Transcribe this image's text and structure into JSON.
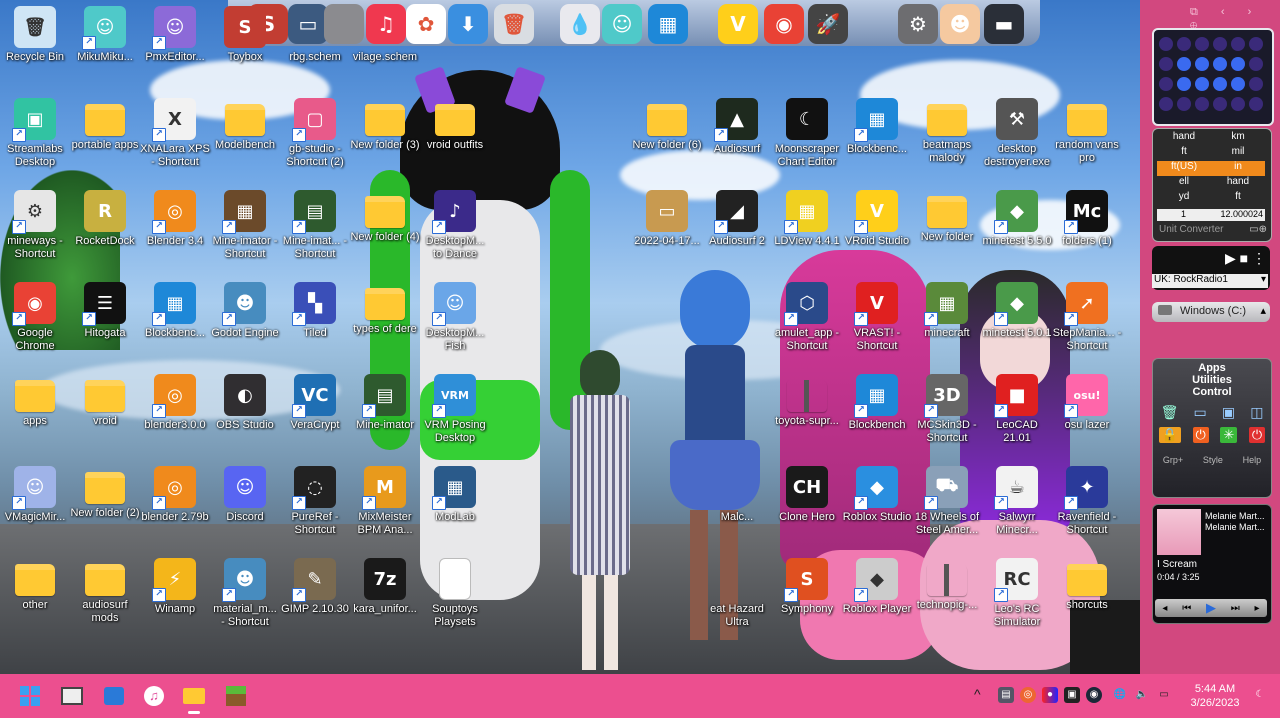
{
  "dock": {
    "items": [
      {
        "name": "toybox-dock",
        "glyph": "S",
        "bg": "#c23d32"
      },
      {
        "name": "monitor-dock",
        "glyph": "▭",
        "bg": "#3c5a80"
      },
      {
        "name": "apple-dock",
        "glyph": "",
        "bg": "#8b8b8f"
      },
      {
        "name": "music-dock",
        "glyph": "♫",
        "bg": "#f0384f"
      },
      {
        "name": "photos-dock",
        "glyph": "✿",
        "bg": "#ffffff"
      },
      {
        "name": "downloads-dock",
        "glyph": "⬇",
        "bg": "#3a8fe0"
      },
      {
        "name": "trash-dock",
        "glyph": "🗑",
        "bg": "#d9dde2"
      },
      {
        "name": "drop-dock",
        "glyph": "💧",
        "bg": "#e9e9ee"
      },
      {
        "name": "miku-dock",
        "glyph": "☺",
        "bg": "#4fc9c9"
      },
      {
        "name": "blockbench-dock",
        "glyph": "▦",
        "bg": "#1e88d8"
      },
      {
        "name": "vroid-dock",
        "glyph": "V",
        "bg": "#ffcf1a"
      },
      {
        "name": "chrome-dock",
        "glyph": "◉",
        "bg": "#e94235"
      },
      {
        "name": "rocket-dock",
        "glyph": "🚀",
        "bg": "#444"
      },
      {
        "name": "settings-dock",
        "glyph": "⚙",
        "bg": "#6d6d70"
      },
      {
        "name": "person-dock",
        "glyph": "☻",
        "bg": "#f5c9a0"
      },
      {
        "name": "window-dock",
        "glyph": "▬",
        "bg": "#2a2f38"
      }
    ]
  },
  "icons": [
    {
      "label": "Recycle Bin",
      "type": "bin",
      "glyph": "🗑",
      "bg": "#cfe5f5",
      "shortcut": false
    },
    {
      "label": "MikuMiku...",
      "type": "app",
      "glyph": "☺",
      "bg": "#4fc9c9",
      "shortcut": true
    },
    {
      "label": "PmxEditor...",
      "type": "app",
      "glyph": "☺",
      "bg": "#8c6ad8",
      "shortcut": true
    },
    {
      "label": "Toybox",
      "type": "app",
      "glyph": "S",
      "bg": "#c23d32",
      "shortcut": false
    },
    {
      "label": "rbg.schem",
      "type": "blank",
      "glyph": "",
      "bg": "transparent",
      "shortcut": false
    },
    {
      "label": "vilage.schem",
      "type": "blank",
      "glyph": "",
      "bg": "transparent",
      "shortcut": false
    },
    {
      "label": "Streamlabs Desktop",
      "type": "app",
      "glyph": "▣",
      "bg": "#31c3a2",
      "shortcut": true
    },
    {
      "label": "portable apps",
      "type": "folder",
      "shortcut": false
    },
    {
      "label": "XNALara XPS - Shortcut",
      "type": "app",
      "glyph": "X",
      "bg": "#f2f2f2",
      "shortcut": true
    },
    {
      "label": "Modelbench",
      "type": "folder",
      "shortcut": false
    },
    {
      "label": "gb-studio - Shortcut (2)",
      "type": "app",
      "glyph": "▢",
      "bg": "#e85a8a",
      "shortcut": true
    },
    {
      "label": "New folder (3)",
      "type": "folder",
      "shortcut": false
    },
    {
      "label": "vroid outfits",
      "type": "folder",
      "shortcut": false
    },
    {
      "label": "mineways - Shortcut",
      "type": "app",
      "glyph": "⚙",
      "bg": "#e6e6e6",
      "shortcut": true
    },
    {
      "label": "RocketDock",
      "type": "app",
      "glyph": "R",
      "bg": "#c8b040",
      "shortcut": false
    },
    {
      "label": "Blender 3.4",
      "type": "app",
      "glyph": "◎",
      "bg": "#f08a1c",
      "shortcut": true
    },
    {
      "label": "Mine-imator - Shortcut",
      "type": "app",
      "glyph": "▦",
      "bg": "#6b4a2a",
      "shortcut": true
    },
    {
      "label": "Mine-imat... - Shortcut",
      "type": "app",
      "glyph": "▤",
      "bg": "#2e5a2e",
      "shortcut": true
    },
    {
      "label": "New folder (4)",
      "type": "folder",
      "shortcut": false
    },
    {
      "label": "DesktopM... to Dance",
      "type": "app",
      "glyph": "♪",
      "bg": "#3b2a8a",
      "shortcut": true
    },
    {
      "label": "Google Chrome",
      "type": "app",
      "glyph": "◉",
      "bg": "#e94235",
      "shortcut": true
    },
    {
      "label": "Hitogata",
      "type": "app",
      "glyph": "☰",
      "bg": "#111111",
      "shortcut": true
    },
    {
      "label": "Blockbenc...",
      "type": "app",
      "glyph": "▦",
      "bg": "#1e88d8",
      "shortcut": true
    },
    {
      "label": "Godot Engine",
      "type": "app",
      "glyph": "☻",
      "bg": "#478cbf",
      "shortcut": true
    },
    {
      "label": "Tiled",
      "type": "app",
      "glyph": "▚",
      "bg": "#3a4fb8",
      "shortcut": true
    },
    {
      "label": "types of dere",
      "type": "folder",
      "shortcut": false
    },
    {
      "label": "DesktopM... Fish",
      "type": "app",
      "glyph": "☺",
      "bg": "#6aa6e8",
      "shortcut": true
    },
    {
      "label": "apps",
      "type": "folder",
      "shortcut": false
    },
    {
      "label": "vroid",
      "type": "folder",
      "shortcut": false
    },
    {
      "label": "blender3.0.0",
      "type": "app",
      "glyph": "◎",
      "bg": "#f08a1c",
      "shortcut": true
    },
    {
      "label": "OBS Studio",
      "type": "app",
      "glyph": "◐",
      "bg": "#302e31",
      "shortcut": false
    },
    {
      "label": "VeraCrypt",
      "type": "app",
      "glyph": "VC",
      "bg": "#1f6fb4",
      "shortcut": true
    },
    {
      "label": "Mine-imator",
      "type": "app",
      "glyph": "▤",
      "bg": "#2e5a2e",
      "shortcut": true
    },
    {
      "label": "VRM Posing Desktop",
      "type": "app",
      "glyph": "VRM",
      "bg": "#2f8fd8",
      "shortcut": true
    },
    {
      "label": "VMagicMir...",
      "type": "app",
      "glyph": "☺",
      "bg": "#9fb3e8",
      "shortcut": true
    },
    {
      "label": "New folder (2)",
      "type": "folder",
      "shortcut": false
    },
    {
      "label": "blender 2.79b",
      "type": "app",
      "glyph": "◎",
      "bg": "#f08a1c",
      "shortcut": true
    },
    {
      "label": "Discord",
      "type": "app",
      "glyph": "☺",
      "bg": "#5865f2",
      "shortcut": false
    },
    {
      "label": "PureRef - Shortcut",
      "type": "app",
      "glyph": "◌",
      "bg": "#222",
      "shortcut": true
    },
    {
      "label": "MixMeister BPM Ana...",
      "type": "app",
      "glyph": "M",
      "bg": "#e89a1c",
      "shortcut": true
    },
    {
      "label": "ModLab",
      "type": "app",
      "glyph": "▦",
      "bg": "#2a5a8a",
      "shortcut": true
    },
    {
      "label": "other",
      "type": "folder",
      "shortcut": false
    },
    {
      "label": "audiosurf mods",
      "type": "folder",
      "shortcut": false
    },
    {
      "label": "Winamp",
      "type": "app",
      "glyph": "⚡",
      "bg": "#f4b61a",
      "shortcut": true
    },
    {
      "label": "material_m... - Shortcut",
      "type": "app",
      "glyph": "☻",
      "bg": "#478cbf",
      "shortcut": true
    },
    {
      "label": "GIMP 2.10.30",
      "type": "app",
      "glyph": "✎",
      "bg": "#7a6a50",
      "shortcut": true
    },
    {
      "label": "kara_unifor...",
      "type": "app",
      "glyph": "7z",
      "bg": "#1a1a1a",
      "shortcut": false
    },
    {
      "label": "Souptoys Playsets",
      "type": "doc",
      "glyph": "",
      "bg": "#ffffff",
      "shortcut": false
    },
    {
      "label": "New folder (6)",
      "type": "folder",
      "shortcut": false
    },
    {
      "label": "Audiosurf",
      "type": "app",
      "glyph": "▲",
      "bg": "#1e2a1e",
      "shortcut": true
    },
    {
      "label": "Moonscraper Chart Editor",
      "type": "app",
      "glyph": "☾",
      "bg": "#111",
      "shortcut": false
    },
    {
      "label": "Blockbenc...",
      "type": "app",
      "glyph": "▦",
      "bg": "#1e88d8",
      "shortcut": true
    },
    {
      "label": "beatmaps malody",
      "type": "folder",
      "shortcut": false
    },
    {
      "label": "desktop destroyer.exe",
      "type": "app",
      "glyph": "⚒",
      "bg": "#555",
      "shortcut": false
    },
    {
      "label": "random vans pro",
      "type": "folder",
      "shortcut": false
    },
    {
      "label": "2022-04-17...",
      "type": "app",
      "glyph": "▭",
      "bg": "#c89a50",
      "shortcut": false
    },
    {
      "label": "Audiosurf 2",
      "type": "app",
      "glyph": "◢",
      "bg": "#222",
      "shortcut": true
    },
    {
      "label": "LDView 4.4.1",
      "type": "app",
      "glyph": "▦",
      "bg": "#f0d020",
      "shortcut": true
    },
    {
      "label": "VRoid Studio",
      "type": "app",
      "glyph": "V",
      "bg": "#ffcf1a",
      "shortcut": true
    },
    {
      "label": "New folder",
      "type": "folder",
      "shortcut": false
    },
    {
      "label": "minetest 5.5.0",
      "type": "app",
      "glyph": "◆",
      "bg": "#4a9a4a",
      "shortcut": true
    },
    {
      "label": "folders (1)",
      "type": "app",
      "glyph": "Mc",
      "bg": "#111",
      "shortcut": true
    },
    {
      "label": "amulet_app - Shortcut",
      "type": "app",
      "glyph": "⬡",
      "bg": "#2a4a8a",
      "shortcut": true
    },
    {
      "label": "VRAST! - Shortcut",
      "type": "app",
      "glyph": "V",
      "bg": "#e02020",
      "shortcut": true
    },
    {
      "label": "minecraft",
      "type": "app",
      "glyph": "▦",
      "bg": "#5a8a3a",
      "shortcut": true
    },
    {
      "label": "minetest 5.0.1",
      "type": "app",
      "glyph": "◆",
      "bg": "#4a9a4a",
      "shortcut": true
    },
    {
      "label": "StepMania... - Shortcut",
      "type": "app",
      "glyph": "➚",
      "bg": "#f07020",
      "shortcut": true
    },
    {
      "label": "toyota-supr...",
      "type": "zip",
      "glyph": "",
      "bg": "#ffd35a",
      "shortcut": false
    },
    {
      "label": "Blockbench",
      "type": "app",
      "glyph": "▦",
      "bg": "#1e88d8",
      "shortcut": true
    },
    {
      "label": "MCSkin3D - Shortcut",
      "type": "app",
      "glyph": "3D",
      "bg": "#666",
      "shortcut": true
    },
    {
      "label": "LeoCAD 21.01",
      "type": "app",
      "glyph": "■",
      "bg": "#e02020",
      "shortcut": true
    },
    {
      "label": "osu lazer",
      "type": "app",
      "glyph": "osu!",
      "bg": "#ff66aa",
      "shortcut": true
    },
    {
      "label": "Malc...",
      "type": "app",
      "glyph": "",
      "bg": "transparent",
      "shortcut": false
    },
    {
      "label": "Clone Hero",
      "type": "app",
      "glyph": "CH",
      "bg": "#1a1a1a",
      "shortcut": false
    },
    {
      "label": "Roblox Studio",
      "type": "app",
      "glyph": "◆",
      "bg": "#2a8fe0",
      "shortcut": true
    },
    {
      "label": "18 Wheels of Steel Amer...",
      "type": "app",
      "glyph": "⛟",
      "bg": "#8aa0b8",
      "shortcut": true
    },
    {
      "label": "Salwyrr Minecr...",
      "type": "app",
      "glyph": "☕",
      "bg": "#f2f2f2",
      "shortcut": true
    },
    {
      "label": "Ravenfield - Shortcut",
      "type": "app",
      "glyph": "✦",
      "bg": "#2a3a9a",
      "shortcut": true
    },
    {
      "label": "eat Hazard Ultra",
      "type": "app",
      "glyph": "",
      "bg": "transparent",
      "shortcut": false
    },
    {
      "label": "Symphony",
      "type": "app",
      "glyph": "S",
      "bg": "#e05020",
      "shortcut": true
    },
    {
      "label": "Roblox Player",
      "type": "app",
      "glyph": "◆",
      "bg": "#cccccc",
      "shortcut": true
    },
    {
      "label": "technopig-...",
      "type": "zip",
      "glyph": "",
      "bg": "#ffd35a",
      "shortcut": false
    },
    {
      "label": "Leo's RC Simulator",
      "type": "app",
      "glyph": "RC",
      "bg": "#f2f2f2",
      "shortcut": true
    },
    {
      "label": "shorcuts",
      "type": "folder",
      "shortcut": false
    }
  ],
  "sidebar": {
    "units": {
      "left_units": [
        "hand",
        "ft",
        "ft(US)",
        "ell",
        "yd"
      ],
      "right_units": [
        "km",
        "mil",
        "in",
        "hand",
        "ft"
      ],
      "input_value": "1",
      "output_value": "12.000024",
      "title": "Unit Converter"
    },
    "radio": {
      "station": "UK: RockRadio1"
    },
    "drive": {
      "label": "Windows (C:)"
    },
    "apps": {
      "title": "Apps",
      "tab2": "Utilities",
      "tab3": "Control",
      "footer": [
        "Grp+",
        "Style",
        "Help"
      ]
    },
    "media": {
      "line1": "Melanie Mart...",
      "line2": "Melanie Mart...",
      "title": "I Scream",
      "time": "0:04 / 3:25"
    }
  },
  "taskbar": {
    "time": "5:44 AM",
    "date": "3/26/2023",
    "bg": "#ec4f8f"
  }
}
